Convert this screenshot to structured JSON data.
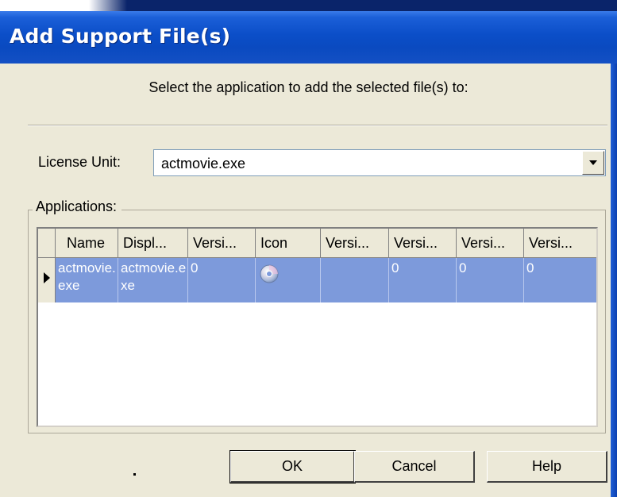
{
  "window": {
    "title": "Add Support File(s)"
  },
  "instruction": "Select the application to add the selected file(s) to:",
  "license_unit": {
    "label": "License Unit:",
    "value": "actmovie.exe"
  },
  "applications": {
    "label": "Applications:",
    "columns": [
      "Name",
      "Displ...",
      "Versi...",
      "Icon",
      "Versi...",
      "Versi...",
      "Versi...",
      "Versi..."
    ],
    "rows": [
      {
        "name": "actmovie.exe",
        "display": "actmovie.exe",
        "v1": "0",
        "icon": "disc-icon",
        "v2": "",
        "v3": "0",
        "v4": "0",
        "v5": "0"
      }
    ]
  },
  "buttons": {
    "dot": ".",
    "ok": "OK",
    "cancel": "Cancel",
    "help": "Help"
  },
  "colors": {
    "title_bar": "#0b4ec8",
    "selection": "#7d9adb",
    "dialog_bg": "#ece9d8"
  }
}
